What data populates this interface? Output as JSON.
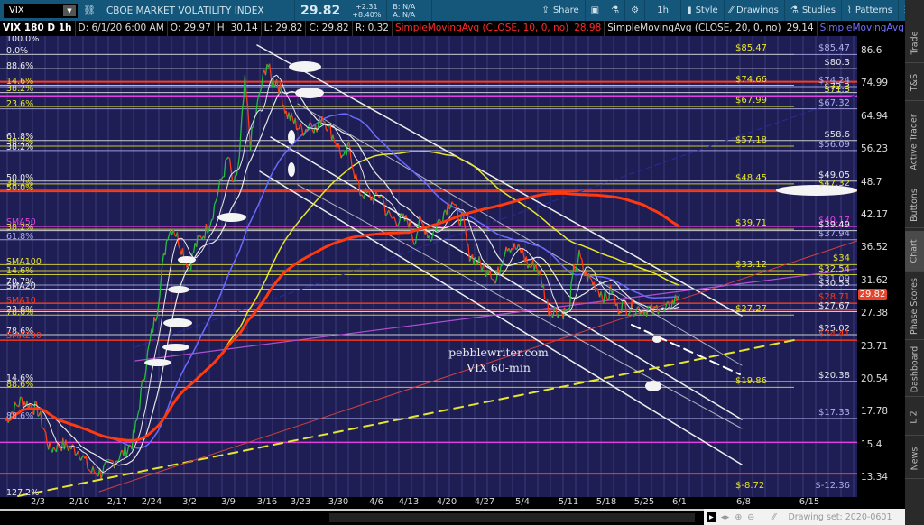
{
  "toolbar": {
    "symbol": "VIX",
    "description": "CBOE MARKET VOLATILITY INDEX",
    "last": "29.82",
    "change": "+2.31",
    "change_pct": "+8.40%",
    "bid": "B: N/A",
    "ask": "A: N/A",
    "share": "Share",
    "timeframe": "1h",
    "style": "Style",
    "drawings": "Drawings",
    "studies": "Studies",
    "patterns": "Patterns"
  },
  "status": {
    "title": "VIX 180 D 1h",
    "date": "D: 6/1/20 6:00 AM",
    "open": "O: 29.97",
    "high": "H: 30.14",
    "low": "L: 29.82",
    "close": "C: 29.82",
    "range": "R: 0.32",
    "sma10_label": "SimpleMovingAvg (CLOSE, 10, 0, no)",
    "sma10_value": "28.98",
    "sma20_label": "SimpleMovingAvg (CLOSE, 20, 0, no)",
    "sma20_value": "29.14",
    "sma50_label": "SimpleMovingAvg (CLOSE, 50, 0,..."
  },
  "colors": {
    "yellow": "#e6e62a",
    "lavender": "#b0b0f0",
    "white": "#e8e8e8",
    "red": "#ff3a1a",
    "magenta": "#e040e0",
    "sma10": "#ff3a1a",
    "sma20": "#e8e8e8",
    "sma50": "#6a6aff",
    "sma100": "#e6e62a",
    "badge": "#e8432a"
  },
  "watermark": {
    "site": "pebblewriter.com",
    "caption": "VIX 60-min"
  },
  "price_levels": [
    {
      "label": "$85.47",
      "value": 85.47,
      "color": "yellow",
      "side": "mid"
    },
    {
      "label": "$85.47",
      "value": 85.47,
      "color": "lavender",
      "side": "right"
    },
    {
      "label": "$80.3",
      "value": 80.3,
      "color": "white",
      "side": "right"
    },
    {
      "label": "$74.66",
      "value": 74.66,
      "color": "yellow",
      "side": "mid"
    },
    {
      "label": "$74.24",
      "value": 74.24,
      "color": "lavender",
      "side": "right"
    },
    {
      "label": "$72.3",
      "value": 72.3,
      "color": "white",
      "side": "right"
    },
    {
      "label": "$71.3",
      "value": 71.3,
      "color": "yellow",
      "side": "right"
    },
    {
      "label": "$67.99",
      "value": 67.99,
      "color": "yellow",
      "side": "mid"
    },
    {
      "label": "$67.32",
      "value": 67.32,
      "color": "lavender",
      "side": "right"
    },
    {
      "label": "$58.6",
      "value": 58.6,
      "color": "white",
      "side": "right"
    },
    {
      "label": "$57.18",
      "value": 57.18,
      "color": "yellow",
      "side": "mid"
    },
    {
      "label": "$56.09",
      "value": 56.09,
      "color": "lavender",
      "side": "right"
    },
    {
      "label": "$49.05",
      "value": 49.05,
      "color": "white",
      "side": "right"
    },
    {
      "label": "$48.45",
      "value": 48.45,
      "color": "yellow",
      "side": "mid"
    },
    {
      "label": "$47.32",
      "value": 47.32,
      "color": "yellow",
      "side": "right"
    },
    {
      "label": "$40.17",
      "value": 40.17,
      "color": "magenta",
      "side": "right"
    },
    {
      "label": "$39.71",
      "value": 39.71,
      "color": "yellow",
      "side": "mid"
    },
    {
      "label": "$39.49",
      "value": 39.49,
      "color": "white",
      "side": "right"
    },
    {
      "label": "$37.94",
      "value": 37.94,
      "color": "lavender",
      "side": "right"
    },
    {
      "label": "$34",
      "value": 34,
      "color": "yellow",
      "side": "right"
    },
    {
      "label": "$33.12",
      "value": 33.12,
      "color": "yellow",
      "side": "mid"
    },
    {
      "label": "$32.54",
      "value": 32.54,
      "color": "yellow",
      "side": "right"
    },
    {
      "label": "$31.09",
      "value": 31.09,
      "color": "lavender",
      "side": "right"
    },
    {
      "label": "$30.53",
      "value": 30.53,
      "color": "white",
      "side": "right"
    },
    {
      "label": "$28.71",
      "value": 28.71,
      "color": "red",
      "side": "right"
    },
    {
      "label": "$27.67",
      "value": 27.67,
      "color": "white",
      "side": "right"
    },
    {
      "label": "$27.27",
      "value": 27.27,
      "color": "yellow",
      "side": "mid"
    },
    {
      "label": "$25.02",
      "value": 25.02,
      "color": "white",
      "side": "right"
    },
    {
      "label": "$24.41",
      "value": 24.41,
      "color": "red",
      "side": "right"
    },
    {
      "label": "$20.38",
      "value": 20.38,
      "color": "white",
      "side": "right"
    },
    {
      "label": "$19.86",
      "value": 19.86,
      "color": "yellow",
      "side": "mid"
    },
    {
      "label": "$17.33",
      "value": 17.33,
      "color": "lavender",
      "side": "right"
    },
    {
      "label": "$-8.72",
      "value": -8.72,
      "color": "yellow",
      "side": "mid"
    },
    {
      "label": "$-12.36",
      "value": -12.36,
      "color": "lavender",
      "side": "right"
    }
  ],
  "fib_labels": [
    {
      "label": "100.0%",
      "color": "white"
    },
    {
      "label": "0.0%",
      "color": "white"
    },
    {
      "label": "88.6%",
      "color": "white"
    },
    {
      "label": "14.6%",
      "color": "yellow"
    },
    {
      "label": "38.2%",
      "color": "yellow"
    },
    {
      "label": "23.6%",
      "color": "yellow"
    },
    {
      "label": "61.8%",
      "color": "white"
    },
    {
      "label": "38.2%",
      "color": "yellow"
    },
    {
      "label": "38.2%",
      "color": "white"
    },
    {
      "label": "50.0%",
      "color": "white"
    },
    {
      "label": "38.2%",
      "color": "yellow"
    },
    {
      "label": "50.0%",
      "color": "yellow"
    },
    {
      "label": "SMA50",
      "color": "magenta"
    },
    {
      "label": "38.2%",
      "color": "yellow"
    },
    {
      "label": "61.8%",
      "color": "lavender"
    },
    {
      "label": "SMA100",
      "color": "yellow"
    },
    {
      "label": "14.6%",
      "color": "yellow"
    },
    {
      "label": "70.7%",
      "color": "white"
    },
    {
      "label": "SMA20",
      "color": "white"
    },
    {
      "label": "SMA10",
      "color": "red"
    },
    {
      "label": "23.6%",
      "color": "white"
    },
    {
      "label": "78.6%",
      "color": "yellow"
    },
    {
      "label": "78.6%",
      "color": "white"
    },
    {
      "label": "SMA200",
      "color": "red"
    },
    {
      "label": "14.6%",
      "color": "white"
    },
    {
      "label": "88.6%",
      "color": "yellow"
    },
    {
      "label": "88.6%",
      "color": "lavender"
    },
    {
      "label": "127.2%",
      "color": "white"
    }
  ],
  "sidebar": [
    "Trade",
    "T&S",
    "Active Trader",
    "Buttons",
    "Chart",
    "Phase Scores",
    "Dashboard",
    "L 2",
    "News"
  ],
  "bottom": {
    "drawing_set": "Drawing set: 2020-0601"
  },
  "chart_data": {
    "type": "line",
    "title": "VIX 180 D 1h",
    "scale": "log",
    "y_ticks": [
      "86.6",
      "74.99",
      "64.94",
      "56.23",
      "48.7",
      "42.17",
      "36.52",
      "31.62",
      "27.38",
      "23.71",
      "20.54",
      "17.78",
      "15.4",
      "13.34"
    ],
    "x_ticks": [
      "2/3",
      "2/10",
      "2/17",
      "2/24",
      "3/2",
      "3/9",
      "3/16",
      "3/23",
      "3/30",
      "4/6",
      "4/13",
      "4/20",
      "4/27",
      "5/4",
      "5/11",
      "5/18",
      "5/25",
      "6/1",
      "6/8",
      "6/15"
    ],
    "ylim": [
      13.34,
      86.6
    ],
    "series": [
      {
        "name": "VIX close",
        "points": [
          [
            "1/28",
            17.2
          ],
          [
            "1/31",
            18.8
          ],
          [
            "2/3",
            17.97
          ],
          [
            "2/5",
            15.15
          ],
          [
            "2/7",
            15.47
          ],
          [
            "2/10",
            15.04
          ],
          [
            "2/12",
            13.74
          ],
          [
            "2/14",
            13.68
          ],
          [
            "2/18",
            14.83
          ],
          [
            "2/20",
            15.56
          ],
          [
            "2/21",
            17.08
          ],
          [
            "2/24",
            25.03
          ],
          [
            "2/25",
            27.85
          ],
          [
            "2/27",
            39.16
          ],
          [
            "2/28",
            40.11
          ],
          [
            "3/2",
            33.42
          ],
          [
            "3/3",
            36.82
          ],
          [
            "3/5",
            39.62
          ],
          [
            "3/6",
            41.94
          ],
          [
            "3/9",
            54.46
          ],
          [
            "3/10",
            47.3
          ],
          [
            "3/11",
            53.9
          ],
          [
            "3/12",
            75.47
          ],
          [
            "3/13",
            57.83
          ],
          [
            "3/16",
            82.69
          ],
          [
            "3/17",
            75.91
          ],
          [
            "3/18",
            76.45
          ],
          [
            "3/19",
            72.0
          ],
          [
            "3/20",
            66.04
          ],
          [
            "3/23",
            61.59
          ],
          [
            "3/24",
            61.67
          ],
          [
            "3/25",
            63.95
          ],
          [
            "3/26",
            61.0
          ],
          [
            "3/27",
            65.54
          ],
          [
            "3/30",
            57.08
          ],
          [
            "3/31",
            53.54
          ],
          [
            "4/1",
            57.06
          ],
          [
            "4/2",
            50.91
          ],
          [
            "4/3",
            46.8
          ],
          [
            "4/6",
            45.24
          ],
          [
            "4/7",
            46.7
          ],
          [
            "4/8",
            43.35
          ],
          [
            "4/9",
            41.67
          ],
          [
            "4/13",
            41.17
          ],
          [
            "4/14",
            37.76
          ],
          [
            "4/15",
            40.84
          ],
          [
            "4/16",
            40.11
          ],
          [
            "4/17",
            38.15
          ],
          [
            "4/20",
            43.83
          ],
          [
            "4/21",
            45.41
          ],
          [
            "4/22",
            41.98
          ],
          [
            "4/23",
            41.38
          ],
          [
            "4/24",
            35.93
          ],
          [
            "4/27",
            33.29
          ],
          [
            "4/28",
            33.57
          ],
          [
            "4/29",
            31.23
          ],
          [
            "4/30",
            34.15
          ],
          [
            "5/1",
            37.19
          ],
          [
            "5/4",
            35.97
          ],
          [
            "5/5",
            33.61
          ],
          [
            "5/6",
            34.12
          ],
          [
            "5/7",
            31.44
          ],
          [
            "5/8",
            27.98
          ],
          [
            "5/11",
            27.57
          ],
          [
            "5/12",
            33.04
          ],
          [
            "5/13",
            35.28
          ],
          [
            "5/14",
            32.61
          ],
          [
            "5/15",
            31.89
          ],
          [
            "5/18",
            29.3
          ],
          [
            "5/19",
            30.53
          ],
          [
            "5/20",
            27.99
          ],
          [
            "5/21",
            28.66
          ],
          [
            "5/22",
            28.16
          ],
          [
            "5/26",
            28.01
          ],
          [
            "5/27",
            27.62
          ],
          [
            "5/28",
            28.59
          ],
          [
            "5/29",
            27.51
          ],
          [
            "6/1",
            29.82
          ]
        ]
      }
    ]
  }
}
